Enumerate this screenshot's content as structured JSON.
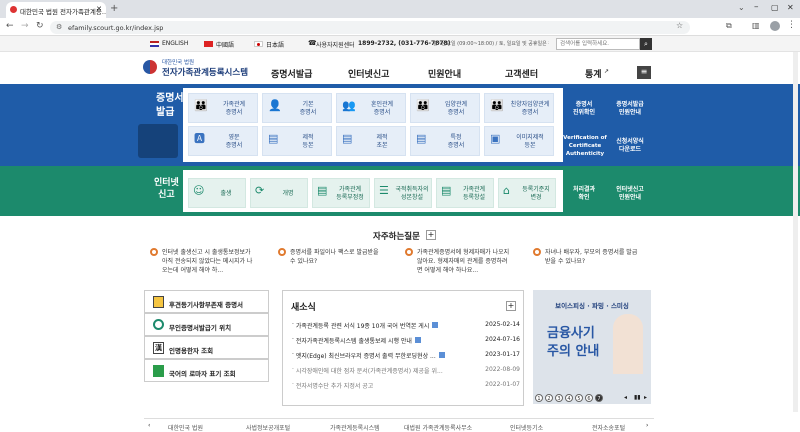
{
  "browser": {
    "tab_title": "대한민국 법원 전자가족관계등...",
    "url": "efamily.scourt.go.kr/index.jsp"
  },
  "topbar": {
    "languages": [
      "ENGLISH",
      "中國語",
      "日本語"
    ],
    "support_label": "사용자지원센터",
    "support_phone": "1899-2732, (031-776-7878)",
    "support_hours": "월~금요일 (09:00~18:00) / 토, 일요일 및 공휴일은 휴무",
    "search_placeholder": "검색어를 입력하세요."
  },
  "header": {
    "logo_small": "대한민국 법원",
    "logo_title": "전자가족관계등록시스템",
    "nav": [
      "증명서발급",
      "인터넷신고",
      "민원안내",
      "고객센터",
      "통계"
    ]
  },
  "issue": {
    "title": "증명서발급",
    "cards": [
      {
        "label": "가족관계\n증명서",
        "icon": "family-icon"
      },
      {
        "label": "기본\n증명서",
        "icon": "person-icon"
      },
      {
        "label": "혼인관계\n증명서",
        "icon": "couple-icon"
      },
      {
        "label": "입양관계\n증명서",
        "icon": "adopt-icon"
      },
      {
        "label": "친양자입양관계\n증명서",
        "icon": "adopt2-icon"
      },
      {
        "label": "영문\n증명서",
        "icon": "doc-a-icon"
      },
      {
        "label": "제적\n등본",
        "icon": "doc-icon"
      },
      {
        "label": "제적\n초본",
        "icon": "doc-icon"
      },
      {
        "label": "특정\n증명서",
        "icon": "doc-icon"
      },
      {
        "label": "이미지제적\n등본",
        "icon": "image-doc-icon"
      }
    ],
    "side": [
      "증명서\n진위확인",
      "증명서발급\n민원안내",
      "Verification of\nCertificate\nAuthenticity",
      "신청서양식\n다운로드"
    ]
  },
  "report": {
    "title": "인터넷\n신고",
    "cards": [
      {
        "label": "출생",
        "icon": "baby-icon"
      },
      {
        "label": "개명",
        "icon": "rename-icon"
      },
      {
        "label": "가족관계\n등록부정정",
        "icon": "doc-icon"
      },
      {
        "label": "국적취득자의\n성본창설",
        "icon": "person-doc-icon"
      },
      {
        "label": "가족관계\n등록창설",
        "icon": "doc-icon"
      },
      {
        "label": "등록기준지\n변경",
        "icon": "house-icon"
      }
    ],
    "side": [
      "처리결과\n확인",
      "인터넷신고\n민원안내"
    ]
  },
  "faq": {
    "title": "자주하는질문",
    "items": [
      "인터넷 출생신고 시 출생통보정보가\n아직 전송되지 않았다는 메시지가 나\n오는데 어떻게 해야 하...",
      "증명서를 파일이나 팩스로 발급받을\n수 있나요?",
      "가족관계증명서에 형제자매가 나오지\n않아요. 형제자매의 관계를 증명하려\n면 어떻게 해야 하나요...",
      "자녀나 배우자, 부모의 증명서를 발급\n받을 수 있나요?"
    ]
  },
  "quick_menu": [
    {
      "label": "후견등기사항부존재 증명서",
      "icon": "cert-icon"
    },
    {
      "label": "무인증명서발급기 위치",
      "icon": "map-pin-icon"
    },
    {
      "label": "인명용한자 조회",
      "icon": "hanja-icon"
    },
    {
      "label": "국어의 로마자 표기 조회",
      "icon": "book-icon"
    }
  ],
  "news": {
    "title": "새소식",
    "items": [
      {
        "title": "가족관계등록 관련 서식 19종 10개 국어 번역본 게시",
        "date": "2025-02-14",
        "is_new": true
      },
      {
        "title": "전자가족관계등록시스템 출생통보제 시행 안내",
        "date": "2024-07-16",
        "is_new": true
      },
      {
        "title": "엣지(Edge) 최신브라우저 증명서 출력 무한로딩현상 ...",
        "date": "2023-01-17",
        "is_new": true
      },
      {
        "title": "시각장애인에 대한 점자 문서(가족관계증명서) 제공을 위...",
        "date": "2022-08-09",
        "is_new": false
      },
      {
        "title": "전자서명수단 추가 지정서 공고",
        "date": "2022-01-07",
        "is_new": false
      }
    ]
  },
  "banner": {
    "top_text": "보이스피싱 · 파밍 · 스미싱",
    "headline1": "금융사기",
    "headline2": "주의 안내",
    "pages": [
      "1",
      "2",
      "3",
      "4",
      "5",
      "6",
      "7"
    ],
    "active_page": "7"
  },
  "footer": {
    "links": [
      "대한민국 법원",
      "사법정보공개포털",
      "가족관계등록시스템",
      "대법원 가족관계등록사무소",
      "인터넷등기소",
      "전자소송포털"
    ]
  },
  "colors": {
    "issue_band": "#1f5ca8",
    "report_band": "#1c8a6c",
    "accent_orange": "#e07a2f"
  }
}
